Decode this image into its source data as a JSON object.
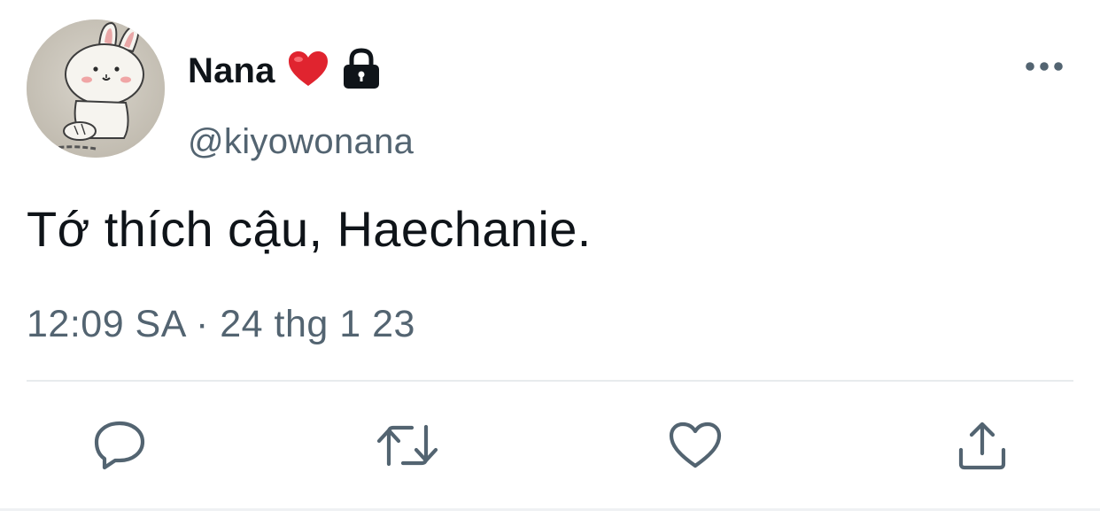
{
  "tweet": {
    "author": {
      "display_name": "Nana",
      "handle": "@kiyowonana",
      "name_emoji": "heart-emoji",
      "protected_icon": "lock-icon",
      "avatar_icon": "bunny-avatar-image"
    },
    "text": "Tớ thích cậu, Haechanie.",
    "timestamp": "12:09 SA · 24 thg 1 23",
    "more_icon": "more-horizontal-icon"
  },
  "actions": [
    {
      "icon": "reply-icon"
    },
    {
      "icon": "retweet-icon"
    },
    {
      "icon": "like-icon"
    },
    {
      "icon": "share-icon"
    }
  ],
  "colors": {
    "text_primary": "#0f1419",
    "text_secondary": "#536471",
    "icon": "#536471",
    "heart": "#e0242f",
    "divider": "#e8ebed"
  }
}
